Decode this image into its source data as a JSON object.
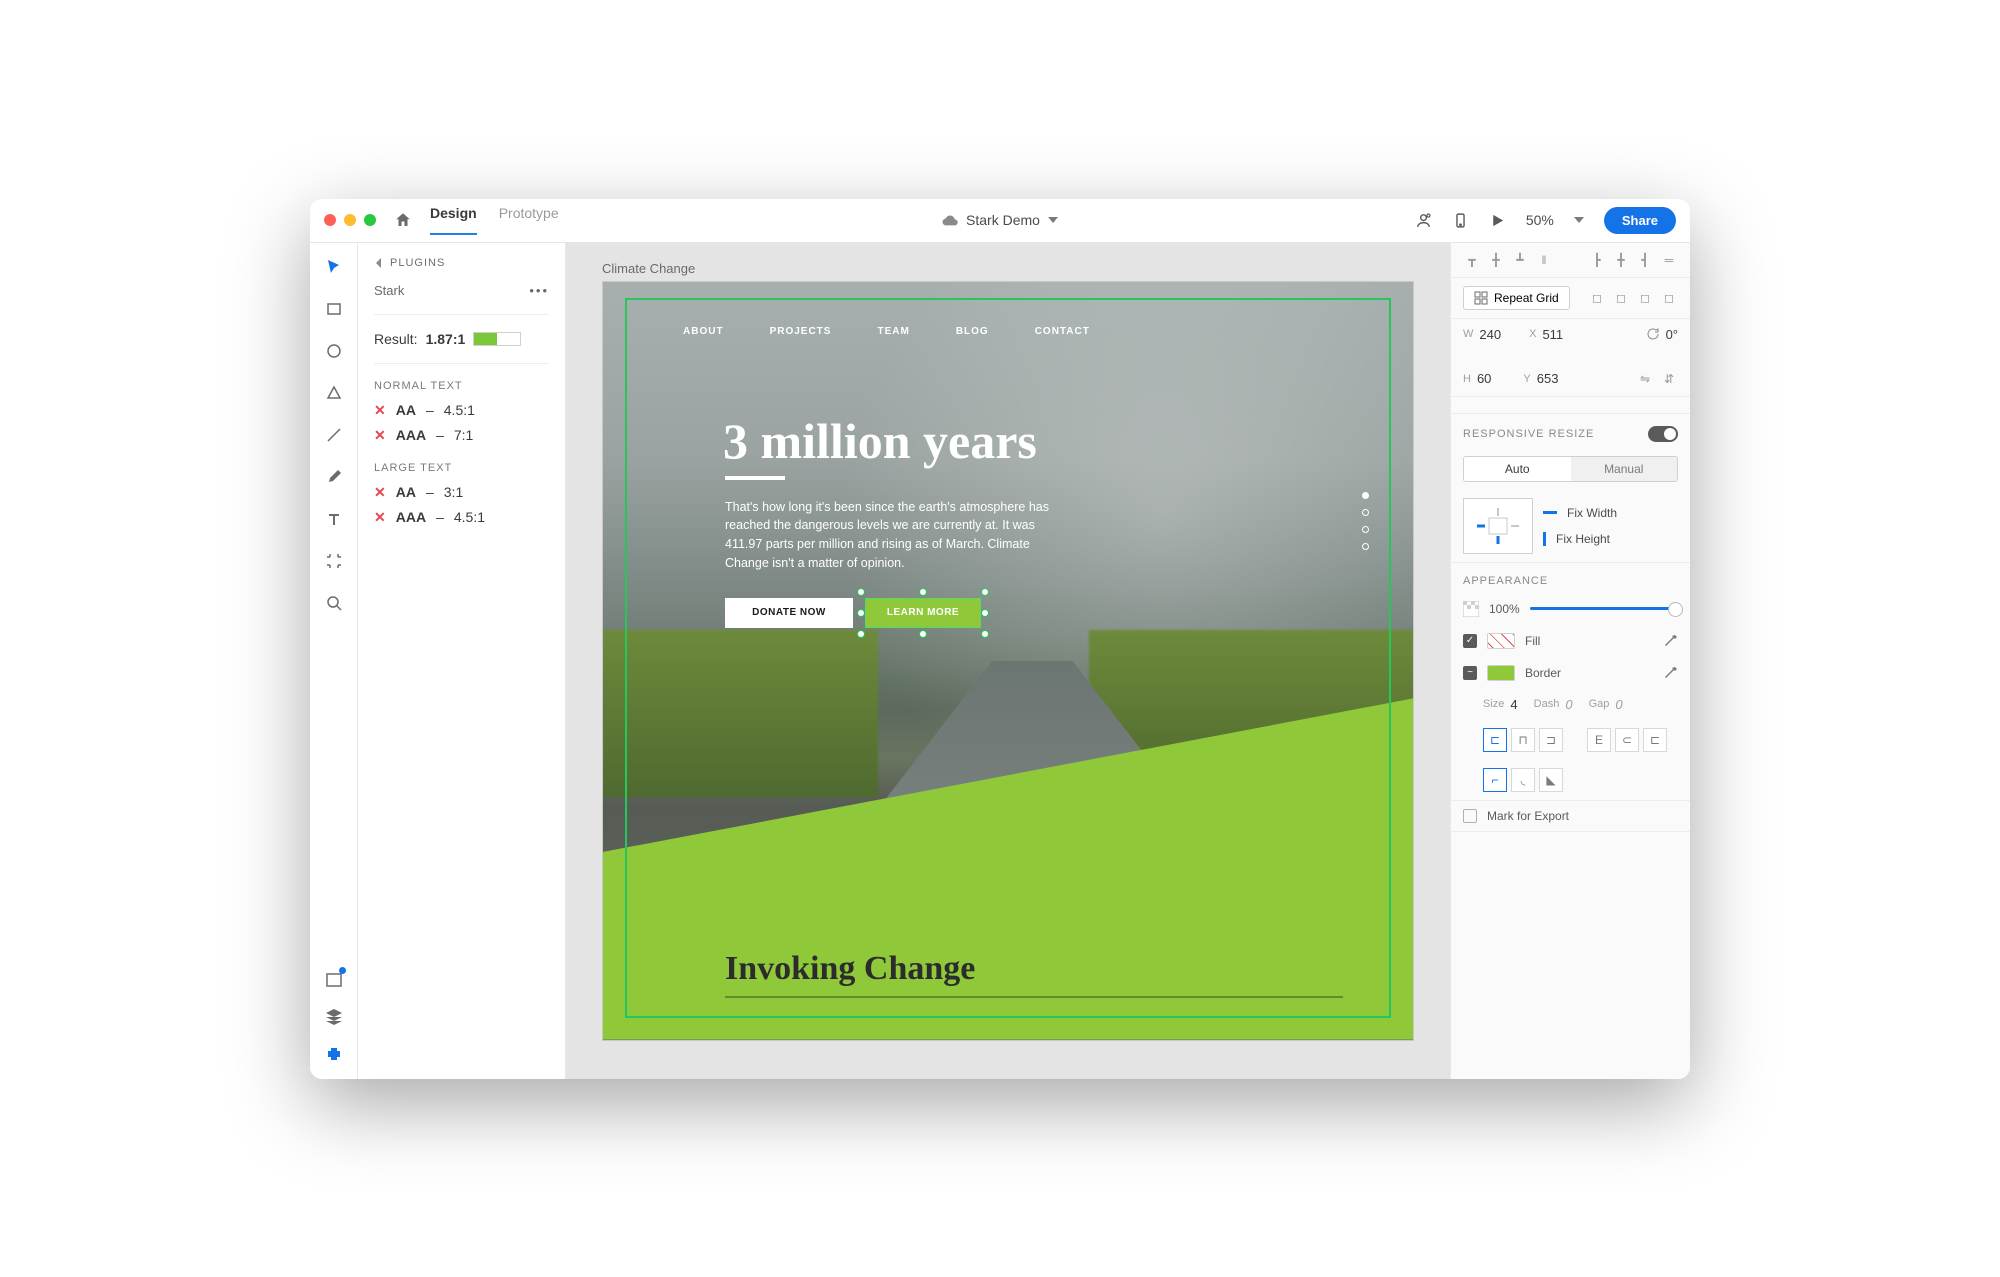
{
  "titlebar": {
    "tabs": [
      "Design",
      "Prototype"
    ],
    "doc_name": "Stark Demo",
    "zoom": "50%",
    "share": "Share"
  },
  "plugin": {
    "header": "PLUGINS",
    "name": "Stark",
    "result_label": "Result:",
    "result_value": "1.87:1",
    "normal_label": "NORMAL TEXT",
    "normal": [
      {
        "grade": "AA",
        "ratio": "4.5:1"
      },
      {
        "grade": "AAA",
        "ratio": "7:1"
      }
    ],
    "large_label": "LARGE TEXT",
    "large": [
      {
        "grade": "AA",
        "ratio": "3:1"
      },
      {
        "grade": "AAA",
        "ratio": "4.5:1"
      }
    ]
  },
  "artboard": {
    "name": "Climate Change",
    "nav": [
      "ABOUT",
      "PROJECTS",
      "TEAM",
      "BLOG",
      "CONTACT"
    ],
    "headline": "3 million years",
    "body": "That's how long it's been since the earth's atmosphere has reached the dangerous levels we are currently at. It was 411.97 parts per million and rising as of March. Climate Change isn't a matter of opinion.",
    "donate": "DONATE NOW",
    "learn": "LEARN MORE",
    "subhead": "Invoking Change"
  },
  "props": {
    "repeat": "Repeat Grid",
    "w": "240",
    "h": "60",
    "x": "511",
    "y": "653",
    "rot": "0°",
    "resp_label": "RESPONSIVE RESIZE",
    "auto": "Auto",
    "manual": "Manual",
    "fix_w": "Fix Width",
    "fix_h": "Fix Height",
    "appearance": "APPEARANCE",
    "opacity": "100%",
    "fill": "Fill",
    "border": "Border",
    "size_l": "Size",
    "size_v": "4",
    "dash_l": "Dash",
    "dash_v": "0",
    "gap_l": "Gap",
    "gap_v": "0",
    "export": "Mark for Export"
  }
}
